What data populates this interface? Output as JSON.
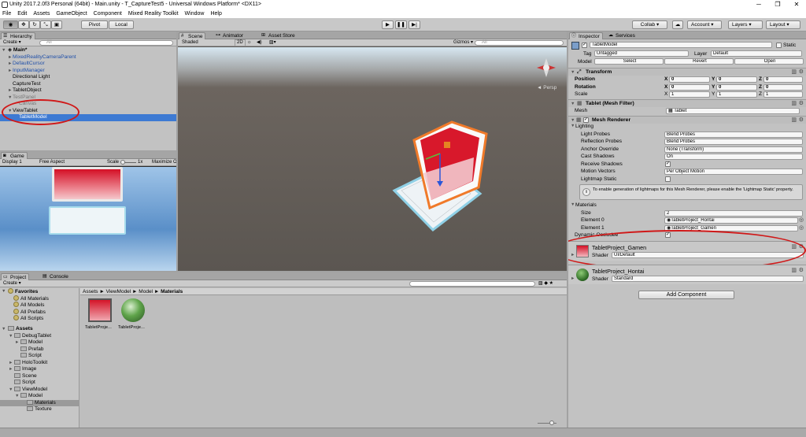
{
  "window": {
    "title": "Unity 2017.2.0f3 Personal (64bit) - Main.unity - T_CaptureTest5 - Universal Windows Platform* <DX11>",
    "min": "─",
    "max": "❐",
    "close": "✕"
  },
  "menu": [
    "File",
    "Edit",
    "Assets",
    "GameObject",
    "Component",
    "Mixed Reality Toolkit",
    "Window",
    "Help"
  ],
  "toolbar": {
    "pivot": "Pivot",
    "local": "Local",
    "play_icon": "play-icon",
    "pause_icon": "pause-icon",
    "step_icon": "step-icon",
    "collab": "Collab ▾",
    "account": "Account",
    "layers": "Layers",
    "layout": "Layout"
  },
  "hierarchy": {
    "tab": "Hierarchy",
    "create": "Create ▾",
    "search_placeholder": "All",
    "scene": "Main*",
    "items": [
      {
        "label": "MixedRealityCameraParent",
        "style": "blue"
      },
      {
        "label": "DefaultCursor",
        "style": "blue"
      },
      {
        "label": "InputManager",
        "style": "blue"
      },
      {
        "label": "Directional Light",
        "style": "normal"
      },
      {
        "label": "CaptureTest",
        "style": "normal"
      },
      {
        "label": "TabletObject",
        "style": "normal"
      },
      {
        "label": "TestPanel",
        "style": "grey"
      },
      {
        "label": "Canvas",
        "style": "grey"
      },
      {
        "label": "ViewTablet",
        "style": "normal"
      },
      {
        "label": "TabletModel",
        "style": "selected"
      }
    ]
  },
  "game": {
    "tab": "Game",
    "display": "Display 1",
    "aspect": "Free Aspect",
    "scale_label": "Scale",
    "scale_value": "1x",
    "maximize": "Maximize On Play"
  },
  "scene": {
    "tabs": [
      "Scene",
      "Animator",
      "Asset Store"
    ],
    "shaded": "Shaded",
    "mode2d": "2D",
    "gizmos": "Gizmos ▾",
    "search_placeholder": "All",
    "persp": "◄ Persp"
  },
  "inspector": {
    "tabs": [
      "Inspector",
      "Services"
    ],
    "object_name": "TabletModel",
    "static_label": "Static",
    "tag_label": "Tag",
    "tag_value": "Untagged",
    "layer_label": "Layer",
    "layer_value": "Default",
    "model_label": "Model",
    "select": "Select",
    "revert": "Revert",
    "open": "Open",
    "transform": {
      "title": "Transform",
      "rows": [
        {
          "label": "Position",
          "x": "0",
          "y": "0",
          "z": "0"
        },
        {
          "label": "Rotation",
          "x": "0",
          "y": "0",
          "z": "0"
        },
        {
          "label": "Scale",
          "x": "1",
          "y": "1",
          "z": "1"
        }
      ]
    },
    "mesh_filter": {
      "title": "Tablet (Mesh Filter)",
      "mesh_label": "Mesh",
      "mesh_value": "Tablet"
    },
    "mesh_renderer": {
      "title": "Mesh Renderer",
      "lighting": "Lighting",
      "light_probes_label": "Light Probes",
      "light_probes_value": "Blend Probes",
      "reflection_probes_label": "Reflection Probes",
      "reflection_probes_value": "Blend Probes",
      "anchor_label": "Anchor Override",
      "anchor_value": "None (Transform)",
      "cast_label": "Cast Shadows",
      "cast_value": "On",
      "receive_label": "Receive Shadows",
      "motion_label": "Motion Vectors",
      "motion_value": "Per Object Motion",
      "lightmap_label": "Lightmap Static",
      "info": "To enable generation of lightmaps for this Mesh Renderer, please enable the 'Lightmap Static' property.",
      "materials": "Materials",
      "size_label": "Size",
      "size_value": "2",
      "el0_label": "Element 0",
      "el0_value": "TabletProject_Hontai",
      "el1_label": "Element 1",
      "el1_value": "TabletProject_Gamen",
      "dynamic_label": "Dynamic Occludee"
    },
    "material1": {
      "name": "TabletProject_Gamen",
      "shader_label": "Shader",
      "shader_value": "UI/Default"
    },
    "material2": {
      "name": "TabletProject_Hontai",
      "shader_label": "Shader",
      "shader_value": "Standard"
    },
    "add_component": "Add Component"
  },
  "project": {
    "tabs": [
      "Project",
      "Console"
    ],
    "create": "Create ▾",
    "favorites": "Favorites",
    "fav_items": [
      "All Materials",
      "All Models",
      "All Prefabs",
      "All Scripts"
    ],
    "assets": "Assets",
    "tree": [
      {
        "label": "DebugTablet",
        "indent": 1
      },
      {
        "label": "Model",
        "indent": 2
      },
      {
        "label": "Prefab",
        "indent": 2
      },
      {
        "label": "Script",
        "indent": 2
      },
      {
        "label": "HoloToolkit",
        "indent": 1
      },
      {
        "label": "Image",
        "indent": 1
      },
      {
        "label": "Scene",
        "indent": 1
      },
      {
        "label": "Script",
        "indent": 1
      },
      {
        "label": "ViewModel",
        "indent": 1
      },
      {
        "label": "Model",
        "indent": 2
      },
      {
        "label": "Materials",
        "indent": 3,
        "selected": true
      },
      {
        "label": "Texture",
        "indent": 3
      }
    ],
    "breadcrumb": [
      "Assets",
      "ViewModel",
      "Model",
      "Materials"
    ],
    "files": [
      "TabletProje...",
      "TabletProje..."
    ]
  }
}
